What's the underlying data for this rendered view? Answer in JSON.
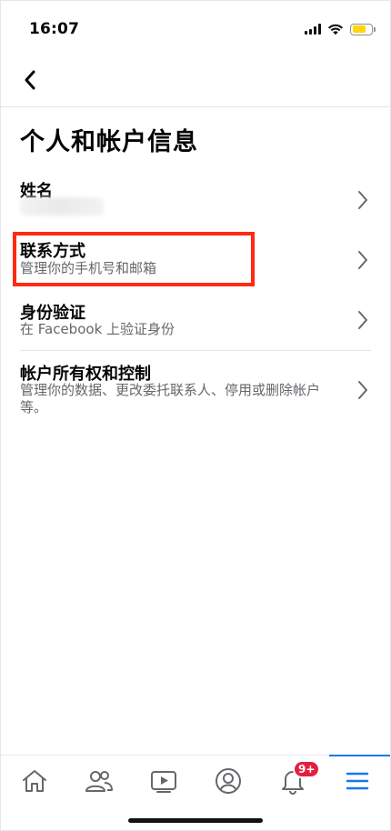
{
  "status_bar": {
    "time": "16:07",
    "battery_level": 0.7,
    "battery_color": "#ffd60a"
  },
  "nav": {
    "back_icon": "chevron-left-icon"
  },
  "page": {
    "title": "个人和帐户信息"
  },
  "items": [
    {
      "title": "姓名",
      "subtitle": "",
      "icon": "chevron-right-icon"
    },
    {
      "title": "联系方式",
      "subtitle": "管理你的手机号和邮箱",
      "icon": "chevron-right-icon",
      "highlighted": true
    },
    {
      "title": "身份验证",
      "subtitle": "在 Facebook 上验证身份",
      "icon": "chevron-right-icon"
    },
    {
      "title": "帐户所有权和控制",
      "subtitle": "管理你的数据、更改委托联系人、停用或删除帐户等。",
      "icon": "chevron-right-icon"
    }
  ],
  "tab_bar": {
    "tabs": [
      {
        "name": "home-icon"
      },
      {
        "name": "friends-icon"
      },
      {
        "name": "watch-icon"
      },
      {
        "name": "profile-icon"
      },
      {
        "name": "notifications-icon",
        "badge": "9+"
      },
      {
        "name": "menu-icon",
        "active": true
      }
    ],
    "accent": "#1877f2",
    "badge_color": "#e41e3f"
  },
  "colors": {
    "highlight_box": "#ff2a12",
    "secondary_text": "#65676b"
  }
}
